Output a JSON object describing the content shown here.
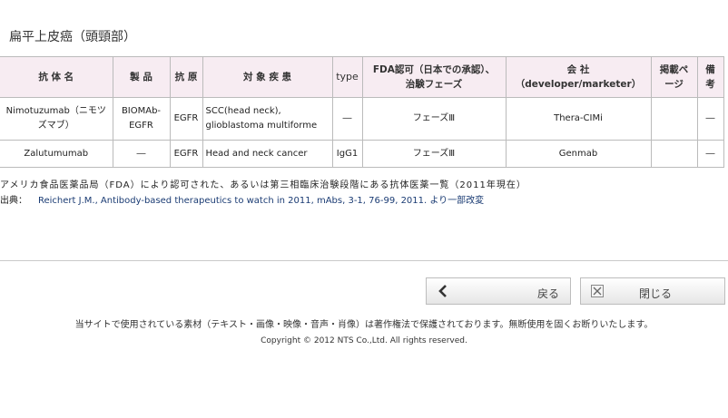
{
  "page_title": "扁平上皮癌（頭頸部）",
  "table": {
    "headers": [
      "抗 体 名",
      "製 品",
      "抗 原",
      "対 象 疾 患",
      "type",
      "FDA認可（日本での承認）、治験フェーズ",
      "会 社\n（developer/marketer）",
      "掲載ページ",
      "備考"
    ],
    "rows": [
      [
        "Nimotuzumab（ニモツズマブ）",
        "BIOMAb-EGFR",
        "EGFR",
        "SCC(head neck),\nglioblastoma multiforme",
        "―",
        "フェーズⅢ",
        "Thera-CIMi",
        "",
        "―"
      ],
      [
        "Zalutumumab",
        "―",
        "EGFR",
        "Head and neck cancer",
        "IgG1",
        "フェーズⅢ",
        "Genmab",
        "",
        "―"
      ]
    ]
  },
  "caption": "アメリカ食品医薬品局（FDA）により認可された、あるいは第三相臨床治験段階にある抗体医薬一覧（2011年現在）",
  "source_label": "出典：",
  "source_ref": "Reichert J.M., Antibody-based therapeutics to watch in 2011, mAbs, 3-1, 76-99, 2011. より一部改変",
  "buttons": {
    "back": "戻る",
    "close": "閉じる"
  },
  "notice": "当サイトで使用されている素材（テキスト・画像・映像・音声・肖像）は著作権法で保護されております。無断使用を固くお断りいたします。",
  "copyright": "Copyright © 2012 NTS Co.,Ltd. All rights reserved.",
  "icons": {
    "back": "chevron-left-icon",
    "close": "close-box-icon"
  }
}
